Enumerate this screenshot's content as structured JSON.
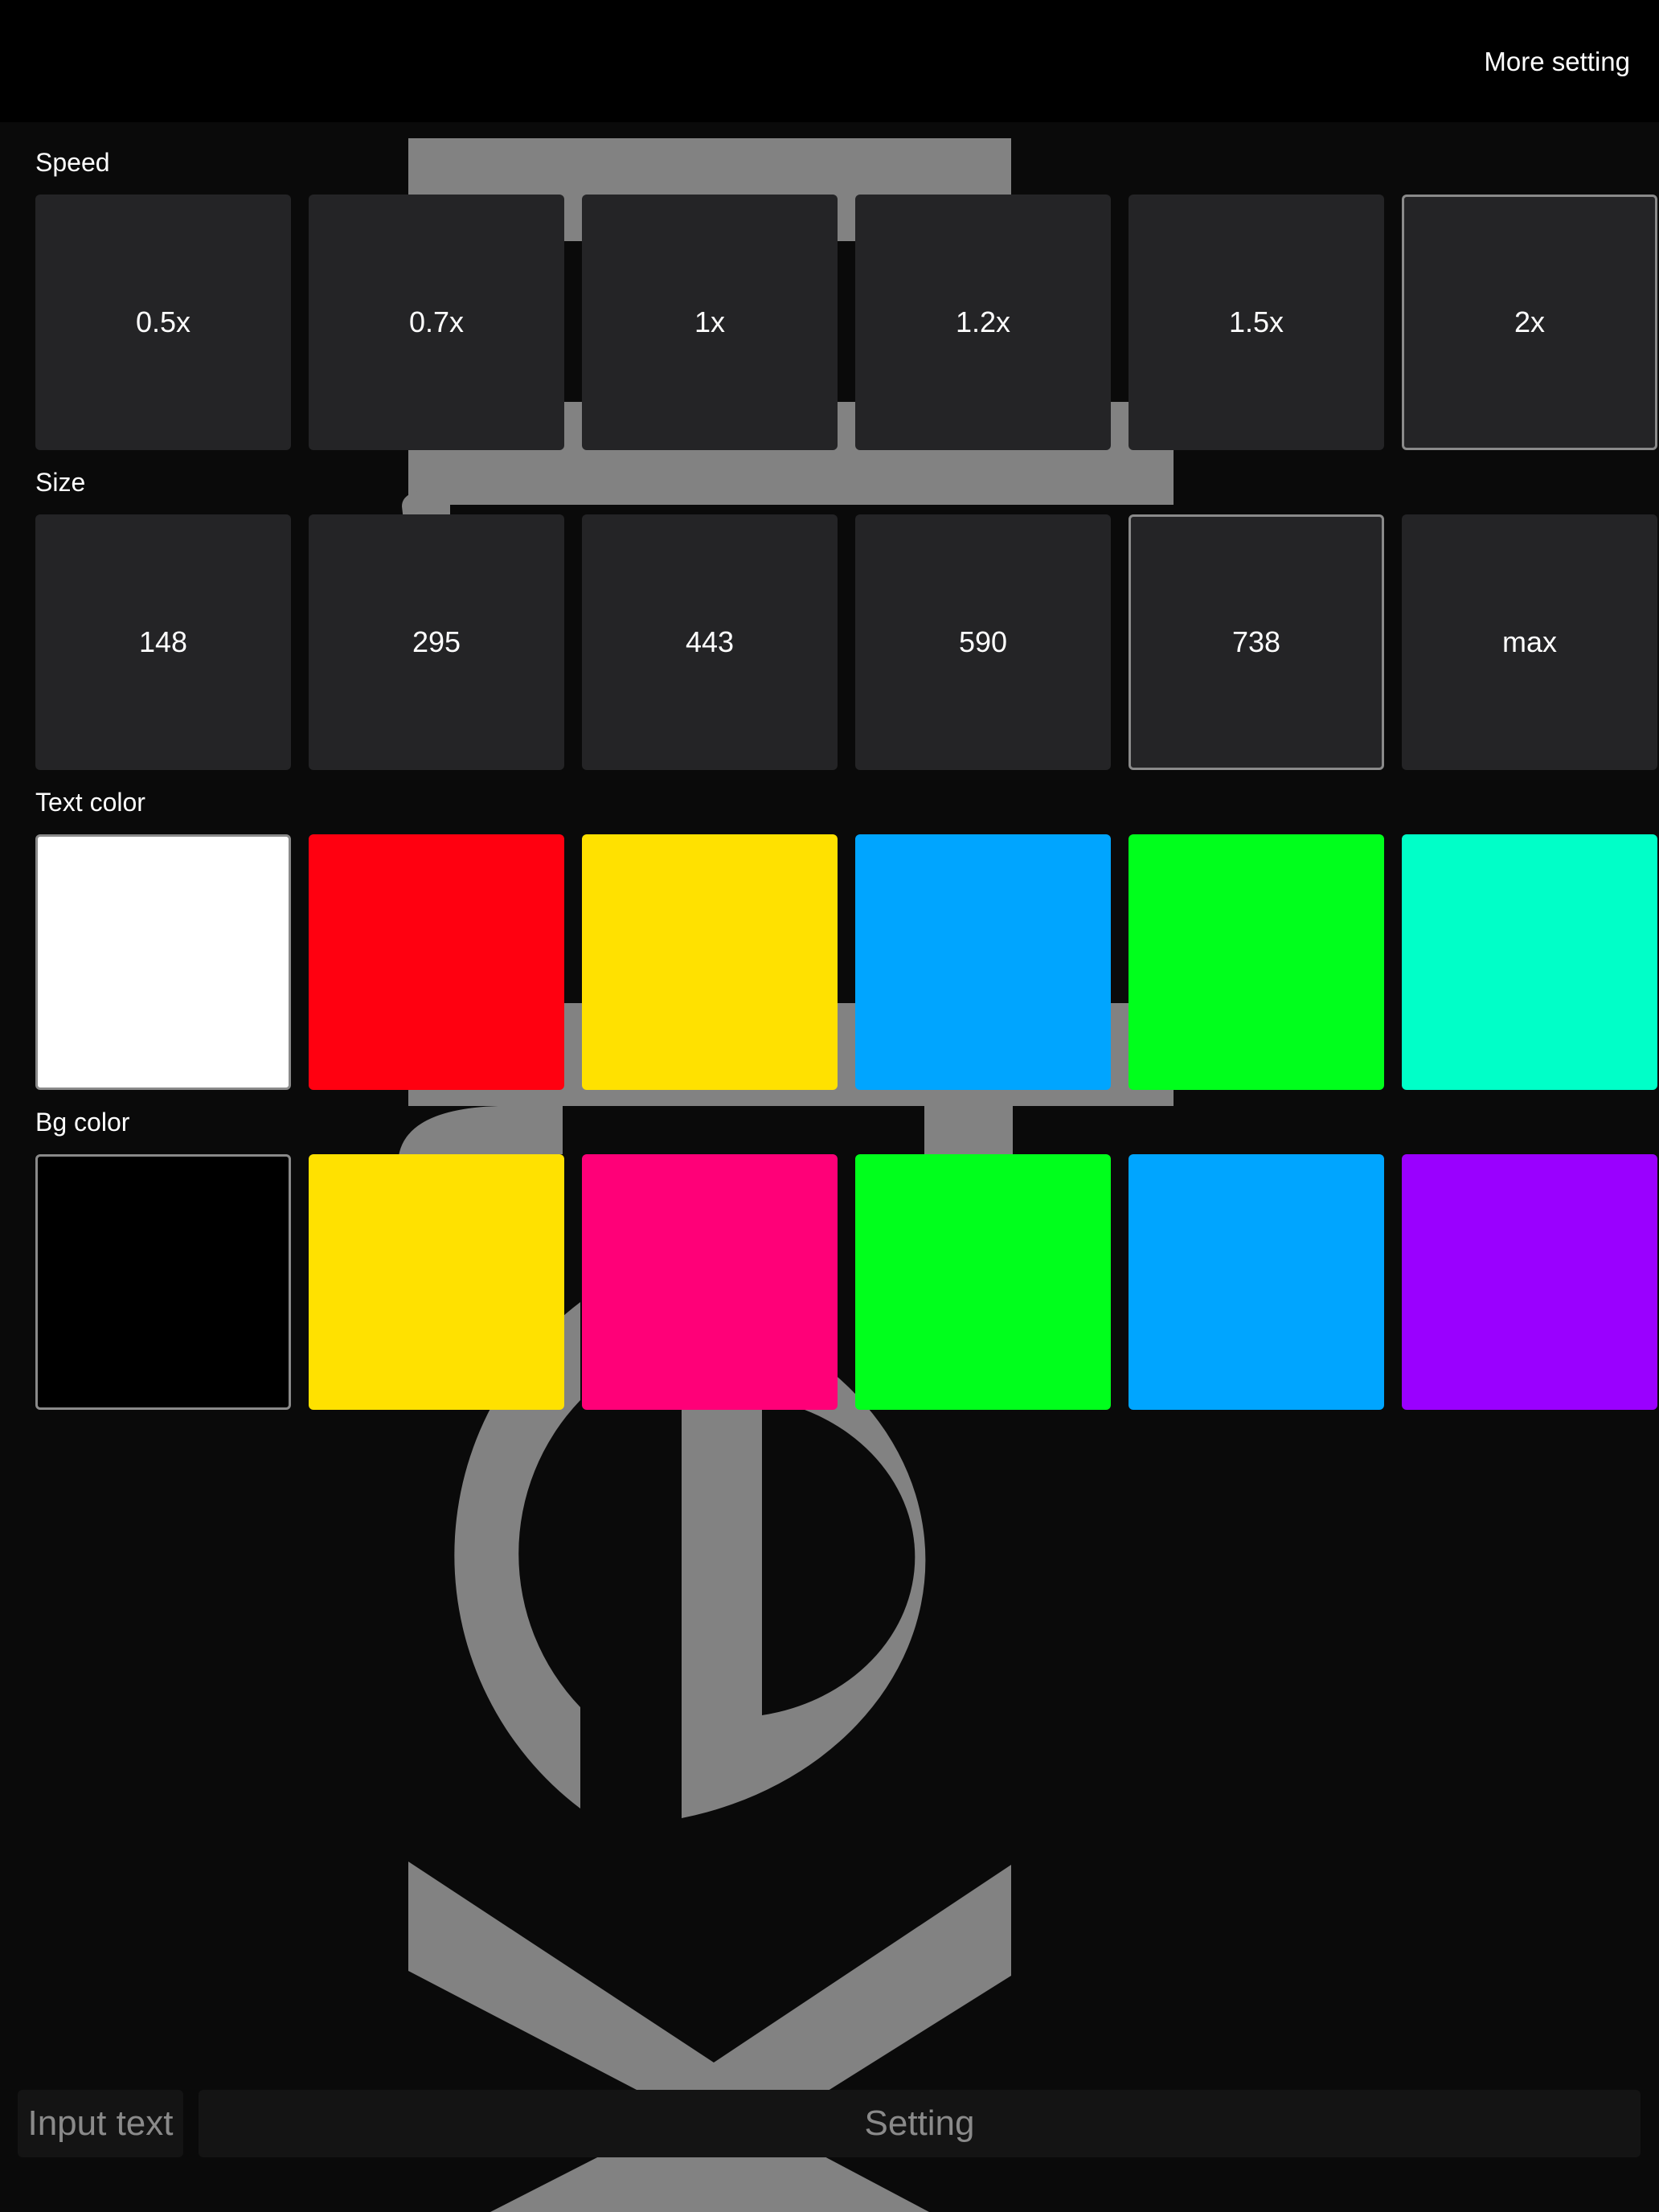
{
  "header": {
    "more_setting_label": "More setting"
  },
  "speed": {
    "label": "Speed",
    "options": [
      "0.5x",
      "0.7x",
      "1x",
      "1.2x",
      "1.5x",
      "2x"
    ],
    "selected": "2x"
  },
  "size": {
    "label": "Size",
    "options": [
      "148",
      "295",
      "443",
      "590",
      "738",
      "max"
    ],
    "selected": "738"
  },
  "text_color": {
    "label": "Text color",
    "options": [
      "#ffffff",
      "#ff0010",
      "#ffe100",
      "#00a5ff",
      "#00ff1c",
      "#00ffc8"
    ],
    "selected": "#ffffff"
  },
  "bg_color": {
    "label": "Bg color",
    "options": [
      "#000000",
      "#ffe100",
      "#ff0078",
      "#00ff1c",
      "#00a5ff",
      "#9a00ff"
    ],
    "selected": "#000000"
  },
  "footer": {
    "input_placeholder": "Input text",
    "setting_label": "Setting"
  },
  "theme": {
    "tile_bg": "#242426",
    "selected_border": "#8a8a8a",
    "background_text_color": "#828282"
  }
}
